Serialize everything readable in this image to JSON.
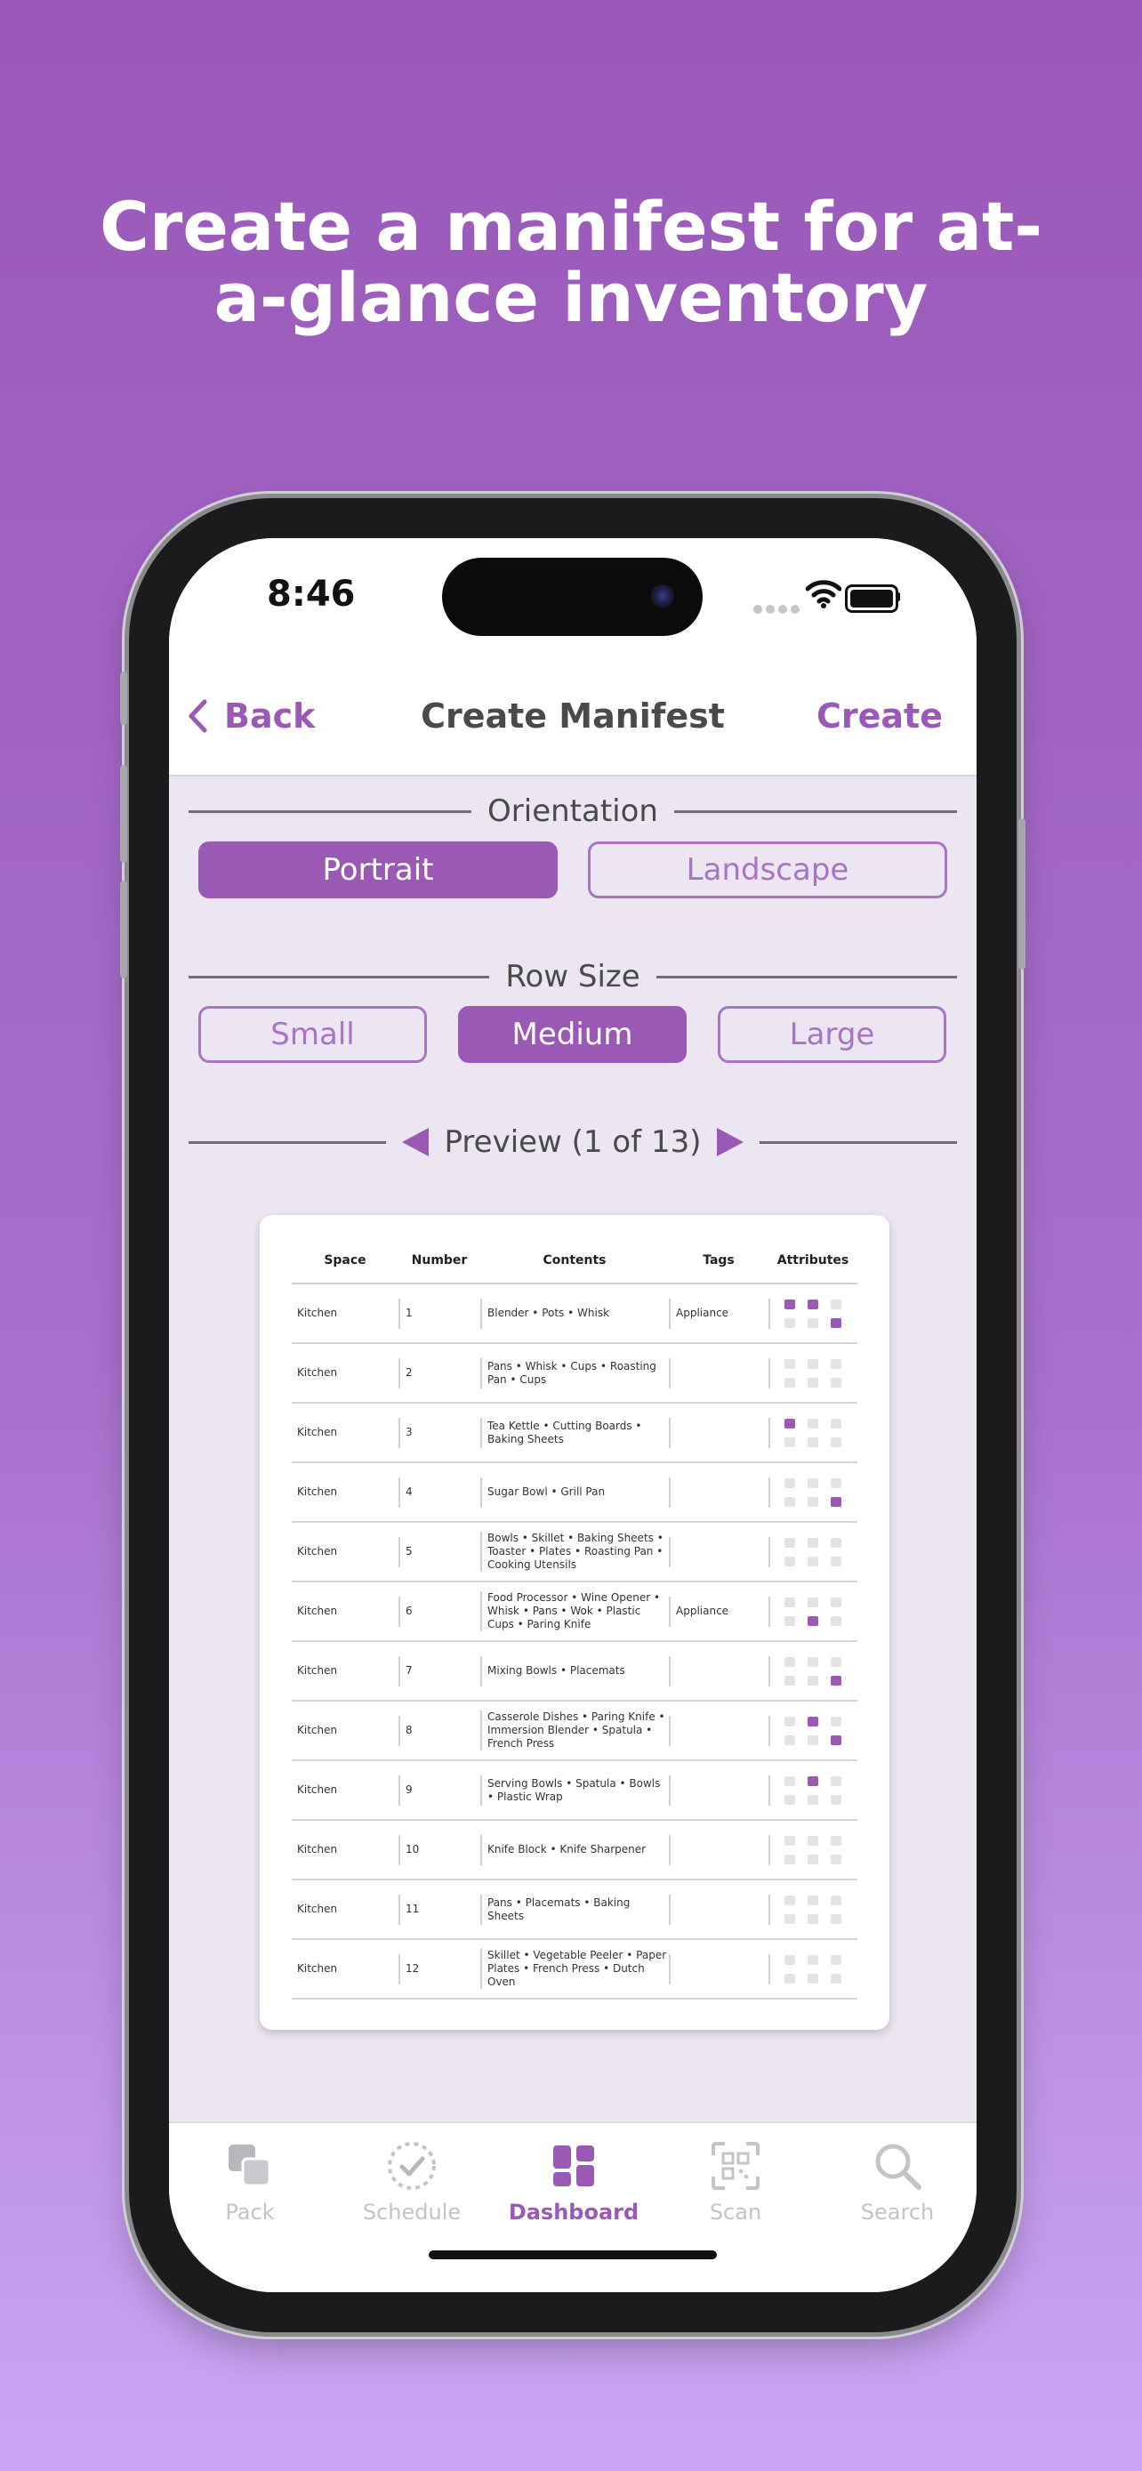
{
  "headline": {
    "line1": "Create a manifest for at-",
    "line2": "a-glance inventory"
  },
  "status_bar": {
    "time": "8:46"
  },
  "nav": {
    "back_label": "Back",
    "title": "Create Manifest",
    "action_label": "Create"
  },
  "orientation": {
    "label": "Orientation",
    "options": [
      "Portrait",
      "Landscape"
    ],
    "selected": "Portrait"
  },
  "row_size": {
    "label": "Row Size",
    "options": [
      "Small",
      "Medium",
      "Large"
    ],
    "selected": "Medium"
  },
  "preview": {
    "label": "Preview (1 of 13)"
  },
  "manifest": {
    "columns": [
      "Space",
      "Number",
      "Contents",
      "Tags",
      "Attributes"
    ],
    "rows": [
      {
        "space": "Kitchen",
        "number": "1",
        "contents": "Blender • Pots • Whisk",
        "tags": "Appliance",
        "attrs": [
          1,
          1,
          0,
          0,
          0,
          1
        ]
      },
      {
        "space": "Kitchen",
        "number": "2",
        "contents": "Pans • Whisk • Cups • Roasting Pan • Cups",
        "tags": "",
        "attrs": [
          0,
          0,
          0,
          0,
          0,
          0
        ]
      },
      {
        "space": "Kitchen",
        "number": "3",
        "contents": "Tea Kettle • Cutting Boards • Baking Sheets",
        "tags": "",
        "attrs": [
          1,
          0,
          0,
          0,
          0,
          0
        ]
      },
      {
        "space": "Kitchen",
        "number": "4",
        "contents": "Sugar Bowl • Grill Pan",
        "tags": "",
        "attrs": [
          0,
          0,
          0,
          0,
          0,
          1
        ]
      },
      {
        "space": "Kitchen",
        "number": "5",
        "contents": "Bowls • Skillet • Baking Sheets • Toaster • Plates • Roasting Pan • Cooking Utensils",
        "tags": "",
        "attrs": [
          0,
          0,
          0,
          0,
          0,
          0
        ]
      },
      {
        "space": "Kitchen",
        "number": "6",
        "contents": "Food Processor • Wine Opener • Whisk • Pans • Wok • Plastic Cups • Paring Knife",
        "tags": "Appliance",
        "attrs": [
          0,
          0,
          0,
          0,
          1,
          0
        ]
      },
      {
        "space": "Kitchen",
        "number": "7",
        "contents": "Mixing Bowls • Placemats",
        "tags": "",
        "attrs": [
          0,
          0,
          0,
          0,
          0,
          1
        ]
      },
      {
        "space": "Kitchen",
        "number": "8",
        "contents": "Casserole Dishes • Paring Knife • Immersion Blender • Spatula • French Press",
        "tags": "",
        "attrs": [
          0,
          1,
          0,
          0,
          0,
          1
        ]
      },
      {
        "space": "Kitchen",
        "number": "9",
        "contents": "Serving Bowls • Spatula • Bowls • Plastic Wrap",
        "tags": "",
        "attrs": [
          0,
          1,
          0,
          0,
          0,
          0
        ]
      },
      {
        "space": "Kitchen",
        "number": "10",
        "contents": "Knife Block • Knife Sharpener",
        "tags": "",
        "attrs": [
          0,
          0,
          0,
          0,
          0,
          0
        ]
      },
      {
        "space": "Kitchen",
        "number": "11",
        "contents": "Pans • Placemats • Baking Sheets",
        "tags": "",
        "attrs": [
          0,
          0,
          0,
          0,
          0,
          0
        ]
      },
      {
        "space": "Kitchen",
        "number": "12",
        "contents": "Skillet • Vegetable Peeler • Paper Plates • French Press • Dutch Oven",
        "tags": "",
        "attrs": [
          0,
          0,
          0,
          0,
          0,
          0
        ]
      }
    ]
  },
  "tabs": [
    {
      "label": "Pack",
      "icon": "pack-icon"
    },
    {
      "label": "Schedule",
      "icon": "schedule-icon"
    },
    {
      "label": "Dashboard",
      "icon": "dashboard-icon",
      "active": true
    },
    {
      "label": "Scan",
      "icon": "scan-icon"
    },
    {
      "label": "Search",
      "icon": "search-icon"
    }
  ],
  "colors": {
    "accent": "#9b59b6",
    "background_top": "#9a58b9",
    "background_bottom": "#cba6f4"
  }
}
